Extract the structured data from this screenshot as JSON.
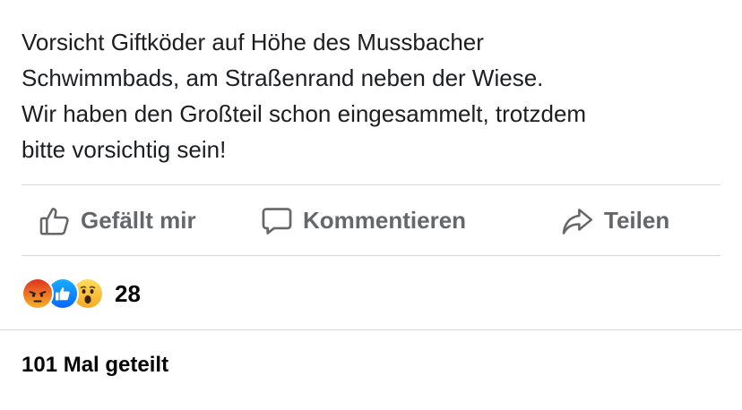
{
  "post": {
    "text_lines": [
      "Vorsicht Giftköder auf Höhe des Mussbacher",
      "Schwimmbads, am Straßenrand neben der Wiese.",
      "Wir haben den Großteil schon eingesammelt, trotzdem",
      "bitte vorsichtig sein!"
    ]
  },
  "actions": {
    "like_label": "Gefällt mir",
    "comment_label": "Kommentieren",
    "share_label": "Teilen"
  },
  "reactions": {
    "icons": [
      "angry-reaction-icon",
      "like-reaction-icon",
      "wow-reaction-icon"
    ],
    "count": "28"
  },
  "shares": {
    "text": "101 Mal geteilt"
  },
  "colors": {
    "action_gray": "#65676b",
    "like_blue": "#1877f2",
    "angry_orange": "#e9710f",
    "wow_yellow": "#f7b125"
  }
}
